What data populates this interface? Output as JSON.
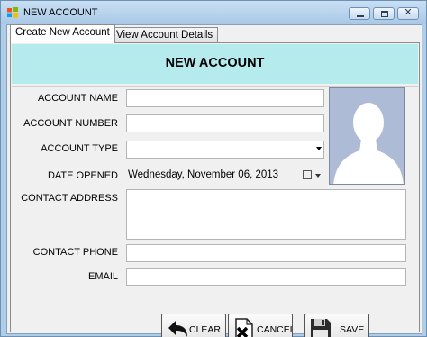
{
  "window": {
    "title": "NEW ACCOUNT"
  },
  "tabs": [
    {
      "label": "Create New Account",
      "active": true
    },
    {
      "label": "View Account Details",
      "active": false
    }
  ],
  "header": {
    "title": "NEW ACCOUNT",
    "background_color": "#b6ebee"
  },
  "form": {
    "account_name": {
      "label": "ACCOUNT NAME",
      "value": ""
    },
    "account_number": {
      "label": "ACCOUNT NUMBER",
      "value": ""
    },
    "account_type": {
      "label": "ACCOUNT TYPE",
      "value": ""
    },
    "date_opened": {
      "label": "DATE OPENED",
      "value": "Wednesday,  November 06, 2013"
    },
    "contact_address": {
      "label": "CONTACT ADDRESS",
      "value": ""
    },
    "contact_phone": {
      "label": "CONTACT PHONE",
      "value": ""
    },
    "email": {
      "label": "EMAIL",
      "value": ""
    }
  },
  "photo": {
    "icon": "person-silhouette-icon"
  },
  "buttons": {
    "clear": {
      "label": "CLEAR",
      "icon": "undo-arrow-icon"
    },
    "cancel": {
      "label": "CANCEL",
      "icon": "cancel-document-icon"
    },
    "save": {
      "label": "SAVE",
      "icon": "floppy-disk-icon"
    }
  }
}
